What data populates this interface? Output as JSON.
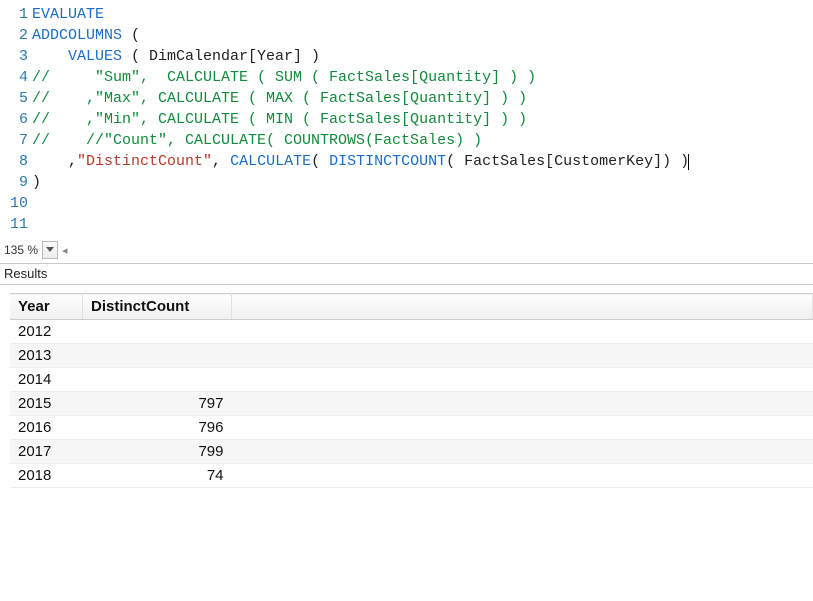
{
  "editor": {
    "lines": [
      {
        "n": 1,
        "segments": [
          {
            "t": "EVALUATE",
            "c": "kw"
          }
        ]
      },
      {
        "n": 2,
        "segments": [
          {
            "t": "ADDCOLUMNS",
            "c": "kw"
          },
          {
            "t": " (",
            "c": "plain"
          }
        ]
      },
      {
        "n": 3,
        "segments": [
          {
            "t": "    ",
            "c": "plain"
          },
          {
            "t": "VALUES",
            "c": "kw"
          },
          {
            "t": " ( DimCalendar[Year] )",
            "c": "plain"
          }
        ]
      },
      {
        "n": 4,
        "segments": [
          {
            "t": "//     \"Sum\",  CALCULATE ( SUM ( FactSales[Quantity] ) )",
            "c": "comment"
          }
        ]
      },
      {
        "n": 5,
        "segments": [
          {
            "t": "//    ,\"Max\", CALCULATE ( MAX ( FactSales[Quantity] ) )",
            "c": "comment"
          }
        ]
      },
      {
        "n": 6,
        "segments": [
          {
            "t": "//    ,\"Min\", CALCULATE ( MIN ( FactSales[Quantity] ) )",
            "c": "comment"
          }
        ]
      },
      {
        "n": 7,
        "segments": [
          {
            "t": "//    //\"Count\", CALCULATE( COUNTROWS(FactSales) )",
            "c": "comment"
          }
        ]
      },
      {
        "n": 8,
        "segments": [
          {
            "t": "    ,",
            "c": "plain"
          },
          {
            "t": "\"DistinctCount\"",
            "c": "str"
          },
          {
            "t": ", ",
            "c": "plain"
          },
          {
            "t": "CALCULATE",
            "c": "kw"
          },
          {
            "t": "( ",
            "c": "plain"
          },
          {
            "t": "DISTINCTCOUNT",
            "c": "kw"
          },
          {
            "t": "( FactSales[CustomerKey]) )",
            "c": "plain"
          }
        ]
      },
      {
        "n": 9,
        "segments": [
          {
            "t": ")",
            "c": "plain"
          }
        ]
      },
      {
        "n": 10,
        "segments": []
      },
      {
        "n": 11,
        "segments": []
      }
    ],
    "cursor_line": 8
  },
  "zoom": {
    "value": "135 %"
  },
  "results": {
    "label": "Results",
    "columns": [
      "Year",
      "DistinctCount"
    ],
    "rows": [
      {
        "year": "2012",
        "dc": ""
      },
      {
        "year": "2013",
        "dc": ""
      },
      {
        "year": "2014",
        "dc": ""
      },
      {
        "year": "2015",
        "dc": "797"
      },
      {
        "year": "2016",
        "dc": "796"
      },
      {
        "year": "2017",
        "dc": "799"
      },
      {
        "year": "2018",
        "dc": "74"
      }
    ]
  }
}
